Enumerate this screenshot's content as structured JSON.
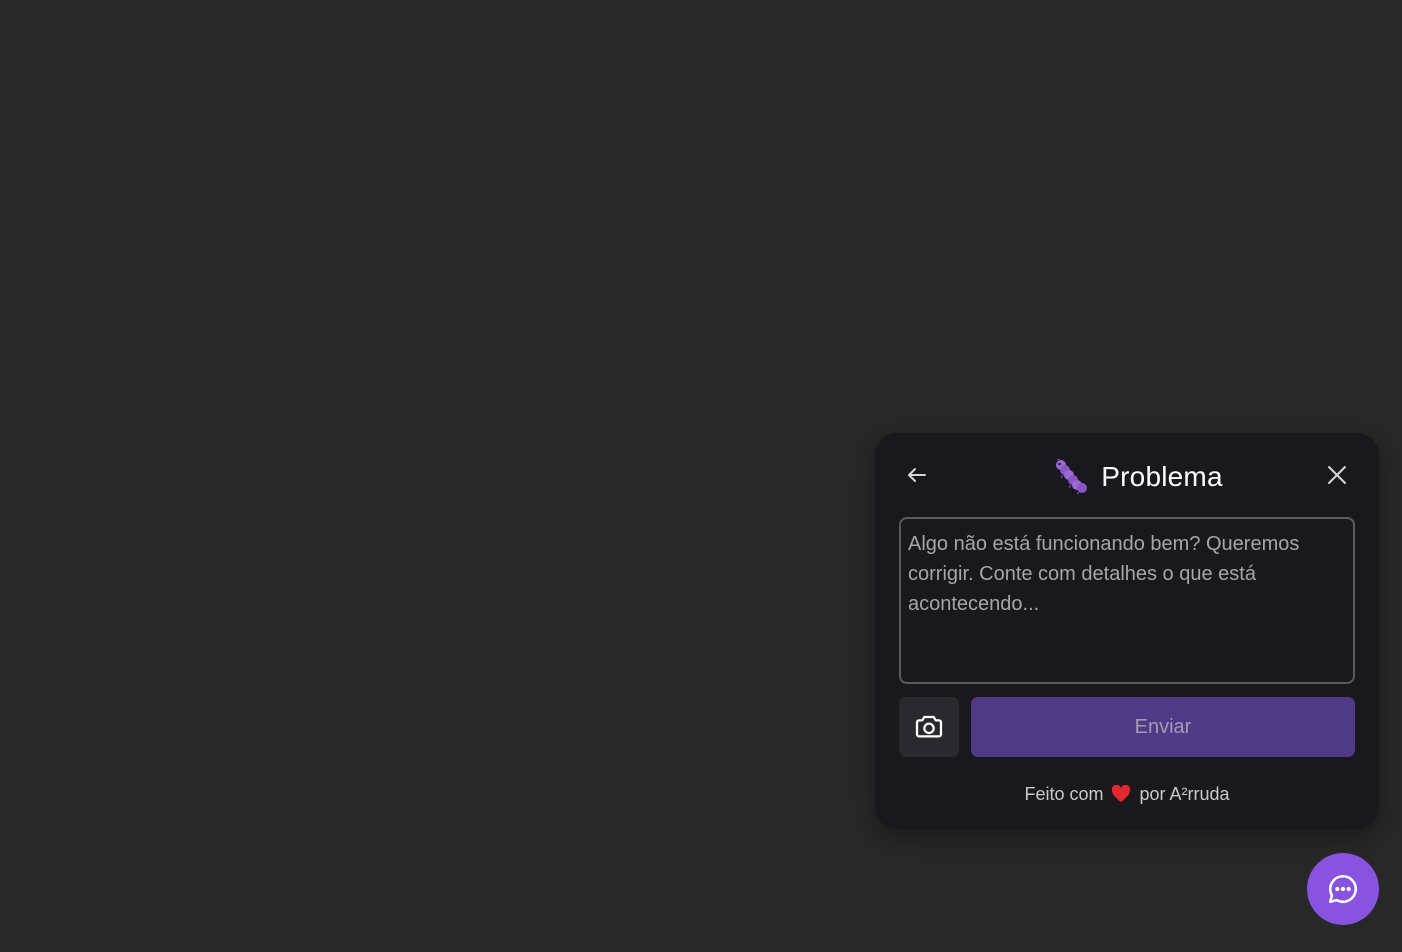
{
  "widget": {
    "title": "Problema",
    "title_emoji": "caterpillar-bug-icon",
    "textarea": {
      "placeholder": "Algo não está funcionando bem? Queremos corrigir. Conte com detalhes o que está acontecendo...",
      "value": ""
    },
    "send_label": "Enviar",
    "footer": {
      "made_with": "Feito com",
      "by": "por A²rruda"
    }
  },
  "colors": {
    "background": "#282828",
    "panel": "#19181d",
    "accent": "#8753e0",
    "send_button": "#4f3a85",
    "heart": "#e5282f"
  },
  "icons": {
    "back": "arrow-left-icon",
    "close": "close-icon",
    "camera": "camera-icon",
    "fab": "chat-bubble-icon"
  }
}
